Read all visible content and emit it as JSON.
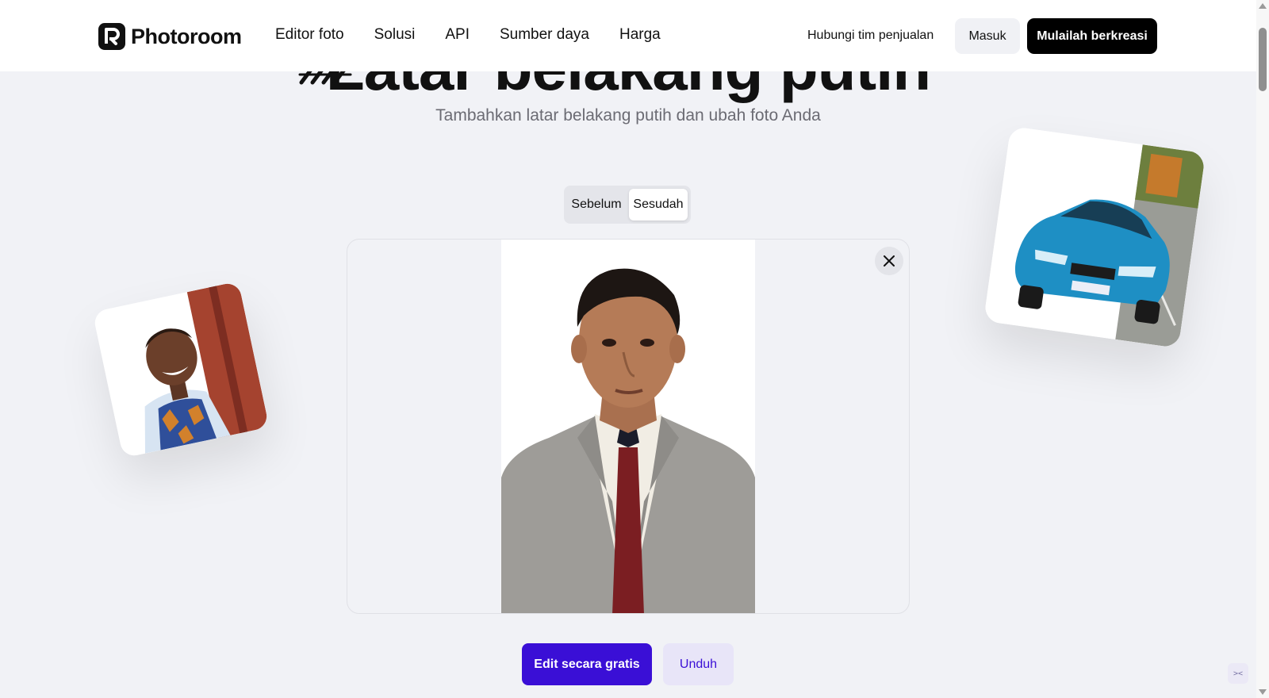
{
  "header": {
    "logo_text": "Photoroom",
    "nav": [
      {
        "label": "Editor foto"
      },
      {
        "label": "Solusi"
      },
      {
        "label": "API"
      },
      {
        "label": "Sumber daya"
      },
      {
        "label": "Harga"
      }
    ],
    "contact_label": "Hubungi tim penjualan",
    "login_label": "Masuk",
    "start_label": "Mulailah berkreasi"
  },
  "hero": {
    "title": "Latar belakang putih",
    "subtitle": "Tambahkan latar belakang putih dan ubah foto Anda"
  },
  "toggle": {
    "before_label": "Sebelum",
    "after_label": "Sesudah",
    "selected": "Sesudah"
  },
  "actions": {
    "edit_label": "Edit secara gratis",
    "download_label": "Unduh"
  },
  "icons": {
    "close": "close-icon",
    "logo": "photoroom-logo-icon",
    "widget": "code-widget-icon"
  },
  "colors": {
    "accent": "#3a0fd6",
    "accent_light": "#e8e5f8",
    "background": "#f1f2f6",
    "header_bg": "#ffffff",
    "primary_dark": "#000000"
  }
}
